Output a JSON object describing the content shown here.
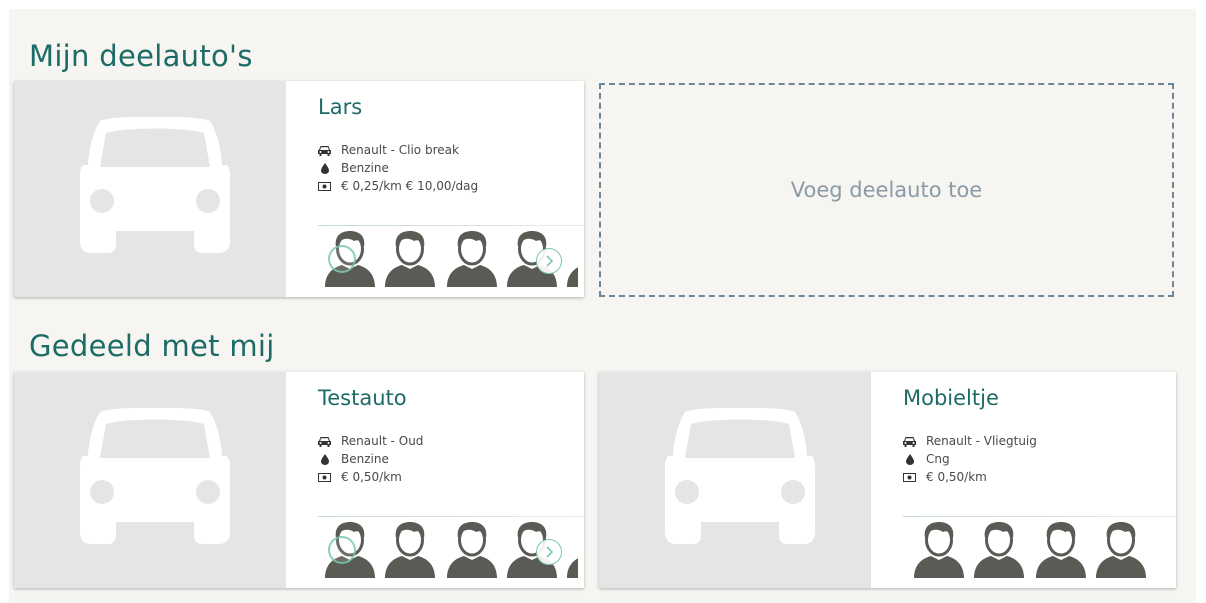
{
  "sections": {
    "mine_title": "Mijn deelauto's",
    "shared_title": "Gedeeld met mij"
  },
  "add_car_label": "Voeg deelauto toe",
  "cars": [
    {
      "name": "Lars",
      "model": "Renault - Clio break",
      "fuel": "Benzine",
      "price": "€ 0,25/km € 10,00/dag",
      "user_count_visible": 4,
      "has_next": true
    },
    {
      "name": "Testauto",
      "model": "Renault - Oud",
      "fuel": "Benzine",
      "price": "€ 0,50/km",
      "user_count_visible": 4,
      "has_next": true
    },
    {
      "name": "Mobieltje",
      "model": "Renault - Vliegtuig",
      "fuel": "Cng",
      "price": "€ 0,50/km",
      "user_count_visible": 4,
      "has_next": false
    }
  ],
  "icons": {
    "car_placeholder": "car-silhouette-icon",
    "model": "car-icon",
    "fuel": "fuel-drop-icon",
    "price": "money-icon",
    "user": "user-avatar-icon",
    "next": "chevron-right-icon",
    "selected": "check-circle-icon"
  },
  "colors": {
    "heading": "#1d6b66",
    "background": "#f6f5f1",
    "image_bg": "#e5e5e5",
    "avatar": "#5a5b55",
    "accent": "#7cc8ad",
    "dashed_border": "#6d8799"
  }
}
